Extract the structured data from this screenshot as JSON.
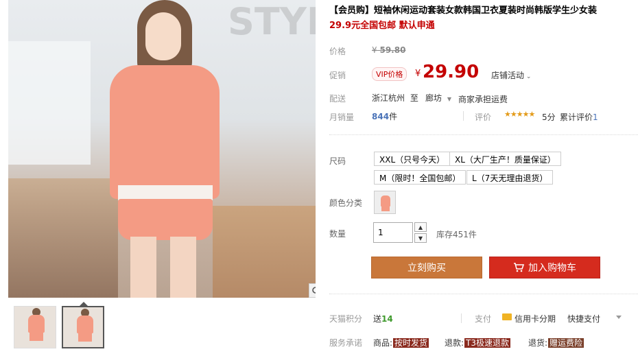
{
  "gallery": {
    "watermark_text": "STYLIS",
    "thumbnails": [
      "thumb-1",
      "thumb-2"
    ],
    "zoom_icon": "magnifier-icon"
  },
  "product": {
    "title": "【会员购】短袖休闲运动套装女款韩国卫衣夏装时尚韩版学生少女装",
    "subtitle": "29.9元全国包邮 默认申通"
  },
  "price": {
    "label": "价格",
    "original": "59.80",
    "currency": "¥",
    "promo_label": "促销",
    "vip_tag": "VIP价格",
    "current": "29.90",
    "shop_activity": "店铺活动"
  },
  "shipping": {
    "label": "配送",
    "from": "浙江杭州",
    "to_word": "至",
    "to": "廊坊",
    "fee": "商家承担运费"
  },
  "sales": {
    "label": "月销量",
    "count": "844",
    "unit": "件",
    "rating_label": "评价",
    "stars": "★★★★★",
    "score": "5分",
    "reviews_text": "累计评价",
    "reviews_count": "1"
  },
  "sku": {
    "size_label": "尺码",
    "sizes": [
      "XXL（只号今天）",
      "XL（大厂生产！质量保证）",
      "M（限时！全国包邮）",
      "L（7天无理由退货）"
    ],
    "color_label": "颜色分类",
    "qty_label": "数量",
    "qty_value": "1",
    "stock": "库存451件"
  },
  "actions": {
    "buy_now": "立刻购买",
    "add_cart": "加入购物车"
  },
  "points": {
    "label": "天猫积分",
    "prefix": "送",
    "value": "14"
  },
  "payment": {
    "label": "支付",
    "credit": "信用卡分期",
    "quick": "快捷支付"
  },
  "promise": {
    "label": "服务承诺",
    "items": [
      {
        "prefix": "商品:",
        "tag": "按时发货",
        "color": "#8a2a1e"
      },
      {
        "prefix": "退款:",
        "tag": "T3极速退款",
        "color": "#8a2a1e"
      },
      {
        "prefix": "退货:",
        "tag": "赠运费险",
        "color": "#7a3f2a"
      }
    ]
  },
  "colors": {
    "accent_red": "#c40000",
    "buy_button": "#c9773a",
    "cart_button": "#d52b1e"
  }
}
